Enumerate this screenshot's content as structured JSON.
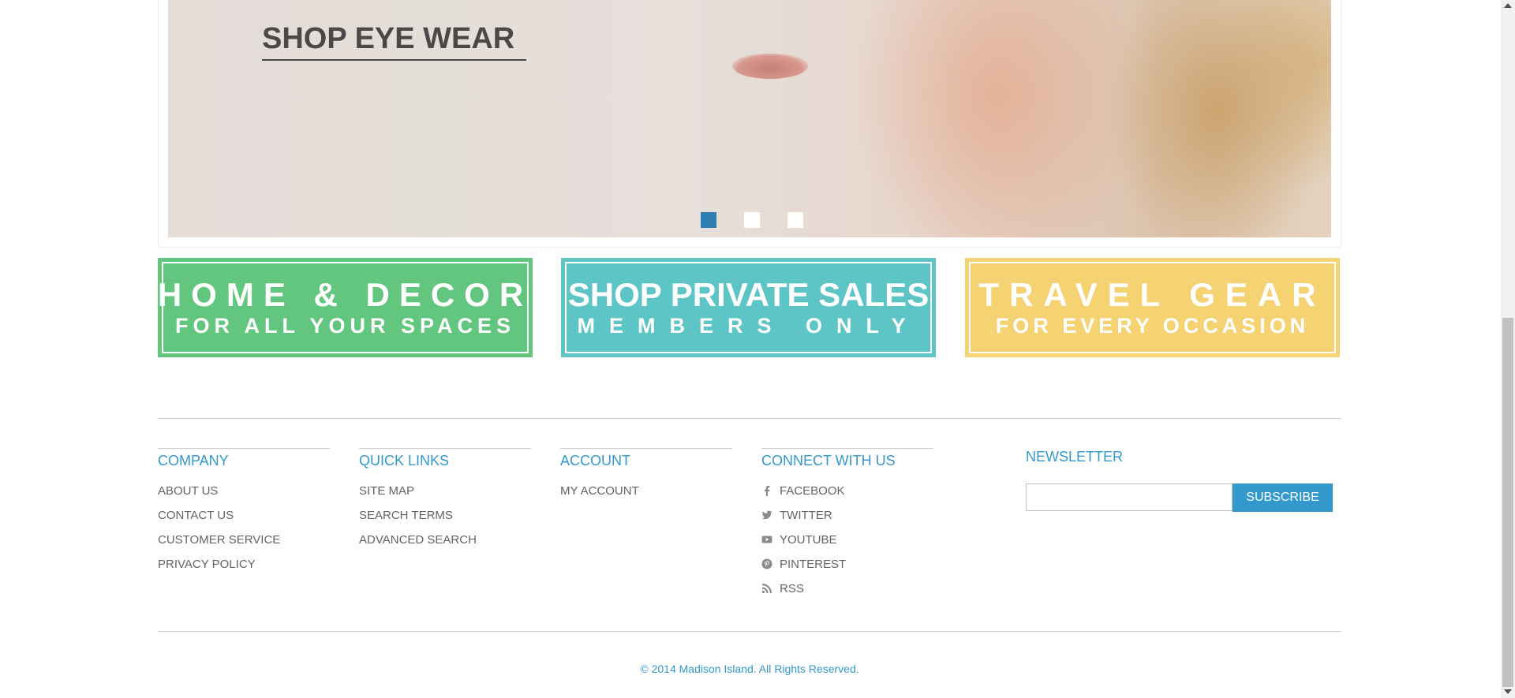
{
  "hero": {
    "title": "SHOP EYE WEAR",
    "slides": [
      {
        "label": "slide-1",
        "active": true
      },
      {
        "label": "slide-2",
        "active": false
      },
      {
        "label": "slide-3",
        "active": false
      }
    ],
    "colors": {
      "dot_active": "#2f7fb0",
      "dot_inactive": "#ffffff",
      "title": "#4a4848"
    }
  },
  "promos": [
    {
      "line1": "HOME & DECOR",
      "line2": "FOR ALL YOUR SPACES",
      "color": "#63c67e"
    },
    {
      "line1": "SHOP PRIVATE SALES",
      "line2": "MEMBERS ONLY",
      "color": "#5ec5c6"
    },
    {
      "line1": "TRAVEL GEAR",
      "line2": "FOR EVERY OCCASION",
      "color": "#f5d272"
    }
  ],
  "footer": {
    "company": {
      "title": "COMPANY",
      "links": [
        "ABOUT US",
        "CONTACT US",
        "CUSTOMER SERVICE",
        "PRIVACY POLICY"
      ]
    },
    "quick_links": {
      "title": "QUICK LINKS",
      "links": [
        "SITE MAP",
        "SEARCH TERMS",
        "ADVANCED SEARCH"
      ]
    },
    "account": {
      "title": "ACCOUNT",
      "links": [
        "MY ACCOUNT"
      ]
    },
    "connect": {
      "title": "CONNECT WITH US",
      "links": [
        {
          "label": "FACEBOOK",
          "icon": "facebook-icon"
        },
        {
          "label": "TWITTER",
          "icon": "twitter-icon"
        },
        {
          "label": "YOUTUBE",
          "icon": "youtube-icon"
        },
        {
          "label": "PINTEREST",
          "icon": "pinterest-icon"
        },
        {
          "label": "RSS",
          "icon": "rss-icon"
        }
      ]
    },
    "newsletter": {
      "title": "NEWSLETTER",
      "input_value": "",
      "button_label": "SUBSCRIBE"
    },
    "copyright": "© 2014 Madison Island. All Rights Reserved.",
    "colors": {
      "accent": "#3399cc",
      "link": "#636363",
      "rule": "#cccccc"
    }
  }
}
